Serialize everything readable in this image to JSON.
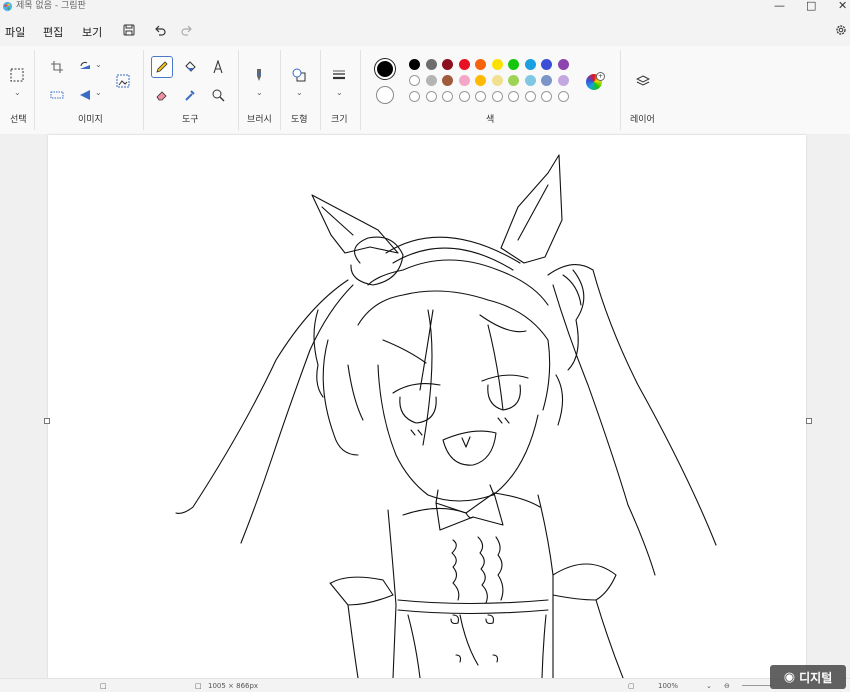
{
  "window": {
    "title": "제목 없음 - 그림판"
  },
  "menu": {
    "file": "파일",
    "edit": "편집",
    "view": "보기"
  },
  "ribbon": {
    "groups": {
      "select": "선택",
      "image": "이미지",
      "tools": "도구",
      "brushes": "브러시",
      "shapes": "도형",
      "size": "크기",
      "colors": "색",
      "layers": "레이어"
    },
    "active_tool": "pencil-icon",
    "primary_color": "#000000",
    "secondary_color": "#ffffff",
    "palette_row1": [
      "#000000",
      "#6e6e6e",
      "#8b0f1e",
      "#e81123",
      "#f7630c",
      "#fce100",
      "#16c60c",
      "#1aa0e0",
      "#3b4fd6",
      "#8e44ad"
    ],
    "palette_row2": [
      "#ffffff",
      "#b4b4b4",
      "#a05a3c",
      "#f4a6c7",
      "#ffb900",
      "#f0e090",
      "#9fd356",
      "#7ec8e3",
      "#7a95c7",
      "#c3a8e0"
    ],
    "palette_empty_count": 10
  },
  "status": {
    "size_text": "1005 × 866px",
    "zoom": "100%"
  },
  "watermark": {
    "text": "디지털"
  }
}
